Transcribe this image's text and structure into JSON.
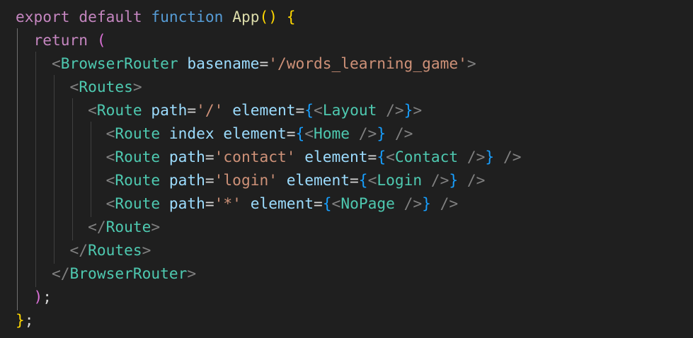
{
  "theme": {
    "background": "#1f1f1f",
    "colors": {
      "keyword": "#c586c0",
      "storage": "#569cd6",
      "function_name": "#dcdcaa",
      "bracket_gold": "#ffd700",
      "bracket_purple": "#da70d6",
      "bracket_blue": "#179fff",
      "tag_punct": "#808080",
      "component": "#4ec9b0",
      "attribute": "#9cdcfe",
      "string": "#ce9178",
      "plain": "#d4d4d4"
    }
  },
  "code_lines": [
    [
      {
        "t": "export",
        "c": "keyword"
      },
      {
        "t": " ",
        "c": "plain"
      },
      {
        "t": "default",
        "c": "keyword"
      },
      {
        "t": " ",
        "c": "plain"
      },
      {
        "t": "function",
        "c": "storage"
      },
      {
        "t": " ",
        "c": "plain"
      },
      {
        "t": "App",
        "c": "function_name"
      },
      {
        "t": "()",
        "c": "bracket_gold"
      },
      {
        "t": " ",
        "c": "plain"
      },
      {
        "t": "{",
        "c": "bracket_gold"
      }
    ],
    [
      {
        "t": "  ",
        "c": "plain"
      },
      {
        "t": "return",
        "c": "keyword"
      },
      {
        "t": " ",
        "c": "plain"
      },
      {
        "t": "(",
        "c": "bracket_purple"
      }
    ],
    [
      {
        "t": "    ",
        "c": "plain"
      },
      {
        "t": "<",
        "c": "tag_punct"
      },
      {
        "t": "BrowserRouter",
        "c": "component"
      },
      {
        "t": " ",
        "c": "plain"
      },
      {
        "t": "basename",
        "c": "attribute"
      },
      {
        "t": "=",
        "c": "plain"
      },
      {
        "t": "'/words_learning_game'",
        "c": "string"
      },
      {
        "t": ">",
        "c": "tag_punct"
      }
    ],
    [
      {
        "t": "      ",
        "c": "plain"
      },
      {
        "t": "<",
        "c": "tag_punct"
      },
      {
        "t": "Routes",
        "c": "component"
      },
      {
        "t": ">",
        "c": "tag_punct"
      }
    ],
    [
      {
        "t": "        ",
        "c": "plain"
      },
      {
        "t": "<",
        "c": "tag_punct"
      },
      {
        "t": "Route",
        "c": "component"
      },
      {
        "t": " ",
        "c": "plain"
      },
      {
        "t": "path",
        "c": "attribute"
      },
      {
        "t": "=",
        "c": "plain"
      },
      {
        "t": "'/'",
        "c": "string"
      },
      {
        "t": " ",
        "c": "plain"
      },
      {
        "t": "element",
        "c": "attribute"
      },
      {
        "t": "=",
        "c": "plain"
      },
      {
        "t": "{",
        "c": "bracket_blue"
      },
      {
        "t": "<",
        "c": "tag_punct"
      },
      {
        "t": "Layout",
        "c": "component"
      },
      {
        "t": " />",
        "c": "tag_punct"
      },
      {
        "t": "}",
        "c": "bracket_blue"
      },
      {
        "t": ">",
        "c": "tag_punct"
      }
    ],
    [
      {
        "t": "          ",
        "c": "plain"
      },
      {
        "t": "<",
        "c": "tag_punct"
      },
      {
        "t": "Route",
        "c": "component"
      },
      {
        "t": " ",
        "c": "plain"
      },
      {
        "t": "index",
        "c": "attribute"
      },
      {
        "t": " ",
        "c": "plain"
      },
      {
        "t": "element",
        "c": "attribute"
      },
      {
        "t": "=",
        "c": "plain"
      },
      {
        "t": "{",
        "c": "bracket_blue"
      },
      {
        "t": "<",
        "c": "tag_punct"
      },
      {
        "t": "Home",
        "c": "component"
      },
      {
        "t": " />",
        "c": "tag_punct"
      },
      {
        "t": "}",
        "c": "bracket_blue"
      },
      {
        "t": " />",
        "c": "tag_punct"
      }
    ],
    [
      {
        "t": "          ",
        "c": "plain"
      },
      {
        "t": "<",
        "c": "tag_punct"
      },
      {
        "t": "Route",
        "c": "component"
      },
      {
        "t": " ",
        "c": "plain"
      },
      {
        "t": "path",
        "c": "attribute"
      },
      {
        "t": "=",
        "c": "plain"
      },
      {
        "t": "'contact'",
        "c": "string"
      },
      {
        "t": " ",
        "c": "plain"
      },
      {
        "t": "element",
        "c": "attribute"
      },
      {
        "t": "=",
        "c": "plain"
      },
      {
        "t": "{",
        "c": "bracket_blue"
      },
      {
        "t": "<",
        "c": "tag_punct"
      },
      {
        "t": "Contact",
        "c": "component"
      },
      {
        "t": " />",
        "c": "tag_punct"
      },
      {
        "t": "}",
        "c": "bracket_blue"
      },
      {
        "t": " />",
        "c": "tag_punct"
      }
    ],
    [
      {
        "t": "          ",
        "c": "plain"
      },
      {
        "t": "<",
        "c": "tag_punct"
      },
      {
        "t": "Route",
        "c": "component"
      },
      {
        "t": " ",
        "c": "plain"
      },
      {
        "t": "path",
        "c": "attribute"
      },
      {
        "t": "=",
        "c": "plain"
      },
      {
        "t": "'login'",
        "c": "string"
      },
      {
        "t": " ",
        "c": "plain"
      },
      {
        "t": "element",
        "c": "attribute"
      },
      {
        "t": "=",
        "c": "plain"
      },
      {
        "t": "{",
        "c": "bracket_blue"
      },
      {
        "t": "<",
        "c": "tag_punct"
      },
      {
        "t": "Login",
        "c": "component"
      },
      {
        "t": " />",
        "c": "tag_punct"
      },
      {
        "t": "}",
        "c": "bracket_blue"
      },
      {
        "t": " />",
        "c": "tag_punct"
      }
    ],
    [
      {
        "t": "          ",
        "c": "plain"
      },
      {
        "t": "<",
        "c": "tag_punct"
      },
      {
        "t": "Route",
        "c": "component"
      },
      {
        "t": " ",
        "c": "plain"
      },
      {
        "t": "path",
        "c": "attribute"
      },
      {
        "t": "=",
        "c": "plain"
      },
      {
        "t": "'*'",
        "c": "string"
      },
      {
        "t": " ",
        "c": "plain"
      },
      {
        "t": "element",
        "c": "attribute"
      },
      {
        "t": "=",
        "c": "plain"
      },
      {
        "t": "{",
        "c": "bracket_blue"
      },
      {
        "t": "<",
        "c": "tag_punct"
      },
      {
        "t": "NoPage",
        "c": "component"
      },
      {
        "t": " />",
        "c": "tag_punct"
      },
      {
        "t": "}",
        "c": "bracket_blue"
      },
      {
        "t": " />",
        "c": "tag_punct"
      }
    ],
    [
      {
        "t": "        ",
        "c": "plain"
      },
      {
        "t": "</",
        "c": "tag_punct"
      },
      {
        "t": "Route",
        "c": "component"
      },
      {
        "t": ">",
        "c": "tag_punct"
      }
    ],
    [
      {
        "t": "      ",
        "c": "plain"
      },
      {
        "t": "</",
        "c": "tag_punct"
      },
      {
        "t": "Routes",
        "c": "component"
      },
      {
        "t": ">",
        "c": "tag_punct"
      }
    ],
    [
      {
        "t": "    ",
        "c": "plain"
      },
      {
        "t": "</",
        "c": "tag_punct"
      },
      {
        "t": "BrowserRouter",
        "c": "component"
      },
      {
        "t": ">",
        "c": "tag_punct"
      }
    ],
    [
      {
        "t": "  ",
        "c": "plain"
      },
      {
        "t": ")",
        "c": "bracket_purple"
      },
      {
        "t": ";",
        "c": "plain"
      }
    ],
    [
      {
        "t": "}",
        "c": "bracket_gold"
      },
      {
        "t": ";",
        "c": "plain"
      }
    ]
  ]
}
